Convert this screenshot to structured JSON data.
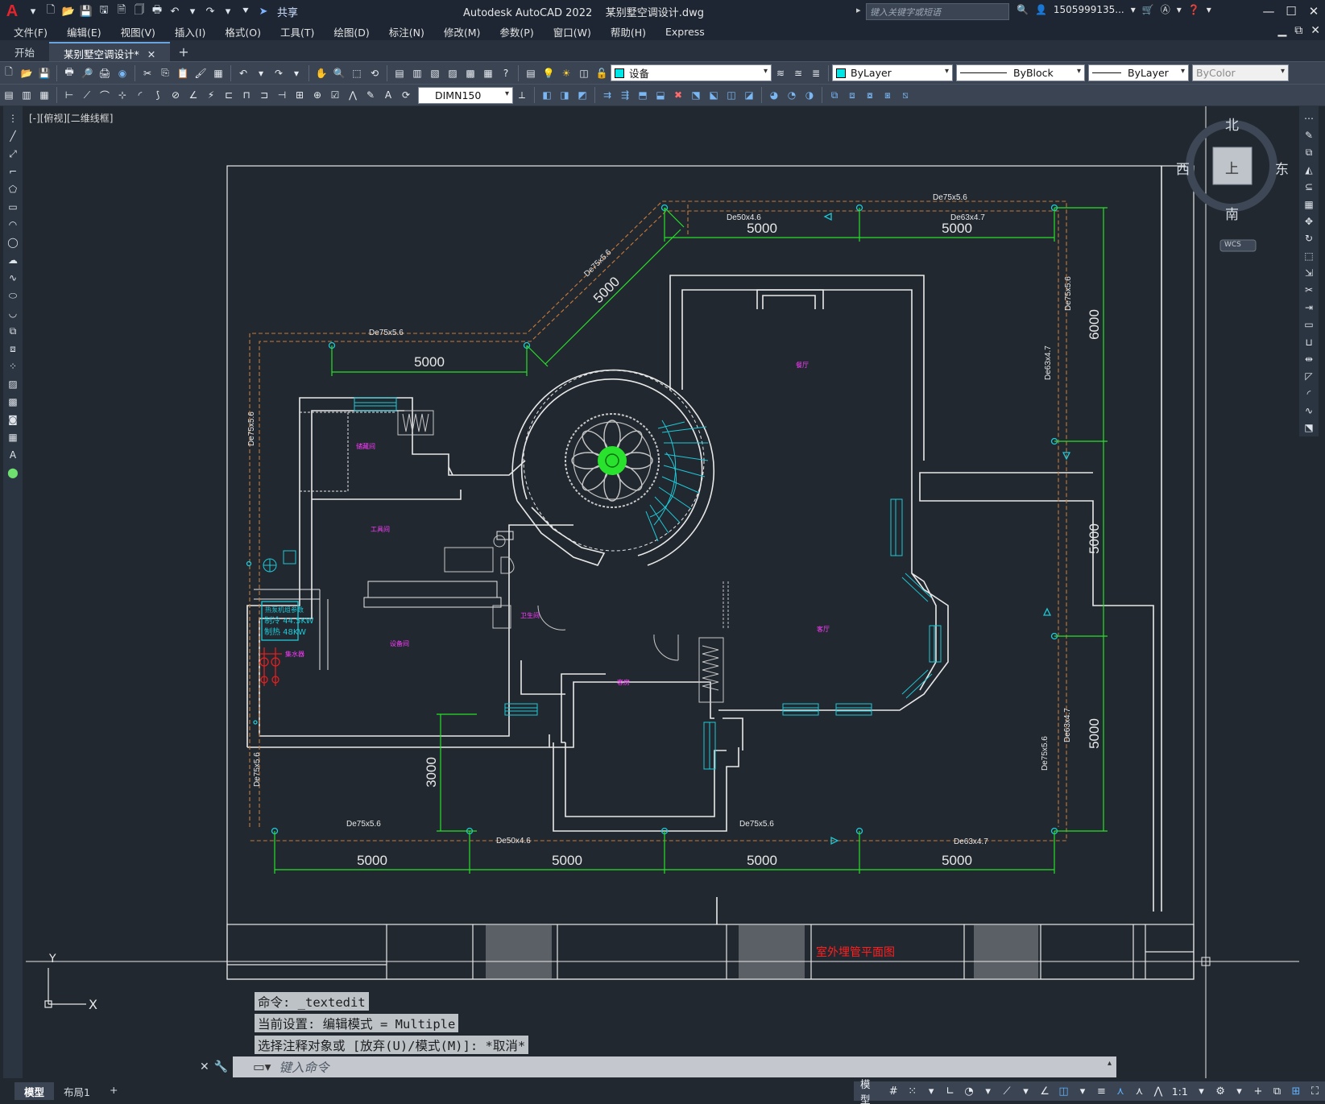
{
  "app": {
    "logo_text": "A",
    "title": "Autodesk AutoCAD 2022",
    "file_name": "某别墅空调设计.dwg",
    "share_label": "共享",
    "search_placeholder": "键入关键字或短语",
    "user_label": "1505999135...",
    "brand_color": "#e2242d"
  },
  "menu": [
    "文件(F)",
    "编辑(E)",
    "视图(V)",
    "插入(I)",
    "格式(O)",
    "工具(T)",
    "绘图(D)",
    "标注(N)",
    "修改(M)",
    "参数(P)",
    "窗口(W)",
    "帮助(H)",
    "Express"
  ],
  "file_tabs": [
    {
      "label": "开始",
      "active": false
    },
    {
      "label": "某别墅空调设计*",
      "active": true
    }
  ],
  "toolbar": {
    "layer_value": "设备",
    "layer_color": "#00e5e5",
    "color_value": "ByLayer",
    "linetype_value": "ByBlock",
    "lineweight_value": "ByLayer",
    "plotstyle_value": "ByColor",
    "dimstyle_value": "DIMN150"
  },
  "viewport_label": "[-][俯视][二维线框]",
  "viewcube": {
    "north": "北",
    "south": "南",
    "east": "东",
    "west": "西",
    "face": "上",
    "ucs_label": "WCS"
  },
  "drawing": {
    "dims": {
      "top_1": "5000",
      "top_2": "5000",
      "diag": "5000",
      "left_top": "5000",
      "right_1": "6000",
      "right_2": "5000",
      "right_3": "5000",
      "bottom_1": "5000",
      "bottom_2": "5000",
      "bottom_3": "5000",
      "bottom_4": "5000",
      "left_vert": "3000"
    },
    "pipes": {
      "de75_top": "De75x5.6",
      "de50_top": "De50x4.6",
      "de63_top": "De63x4.7",
      "de75_diag": "De75x5.6",
      "de75_left_top": "De75x5.6",
      "de75_left_vert": "De75x5.6",
      "de75_right_vert": "De75x5.6",
      "de63_right_vert": "De63x4.7",
      "de75_left_lower": "De75x5.6",
      "de75_bottom_left": "De75x5.6",
      "de50_bottom": "De50x4.6",
      "de75_bottom_mid": "De75x5.6",
      "de63_bottom": "De63x4.7",
      "de75_right_lower": "De75x5.6",
      "de63_right_lower": "De63x4.7"
    },
    "unit_box": {
      "line1": "热泵机组参数",
      "line2": "制冷 44.5KW",
      "line3": "制热 48KW"
    },
    "rooms": {
      "r1": "储藏间",
      "r2": "工具间",
      "r3": "设备间",
      "r4": "卫生间",
      "r5": "客房",
      "r6": "餐厅",
      "r7": "客厅",
      "r8": "集水器"
    },
    "title_block_text": "室外埋管平面图",
    "axis_x": "X",
    "axis_y": "Y"
  },
  "command_history": [
    "命令: _textedit",
    "当前设置: 编辑模式 = Multiple",
    "选择注释对象或 [放弃(U)/模式(M)]: *取消*"
  ],
  "command_placeholder": "键入命令",
  "layout_tabs": [
    {
      "label": "模型",
      "active": true
    },
    {
      "label": "布局1",
      "active": false
    }
  ],
  "status": {
    "model_label": "模型",
    "scale_label": "1:1"
  }
}
